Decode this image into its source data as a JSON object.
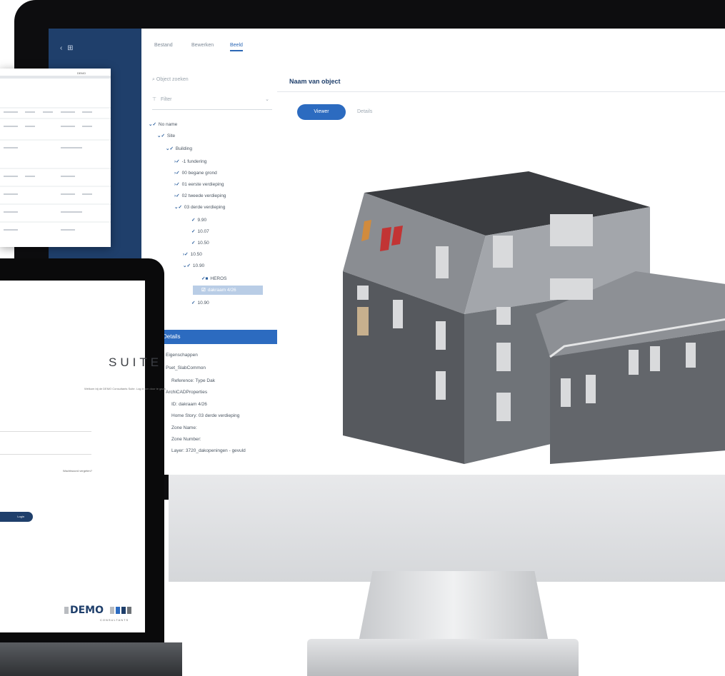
{
  "monitor": {
    "app": {
      "nav_label": "‹ ⊞",
      "tabs": [
        {
          "label": "Bestand"
        },
        {
          "label": "Bewerken"
        },
        {
          "label": "Beeld"
        }
      ],
      "tree": {
        "search_placeholder": "Object zoeken",
        "filter_placeholder": "Filter",
        "items": [
          {
            "label": "No name"
          },
          {
            "label": "Site"
          },
          {
            "label": "Building"
          },
          {
            "label": "-1 fundering"
          },
          {
            "label": "00 begane grond"
          },
          {
            "label": "01 eerste verdieping"
          },
          {
            "label": "02 tweede verdieping"
          },
          {
            "label": "03 derde verdieping"
          },
          {
            "label": "9.90"
          },
          {
            "label": "10.07"
          },
          {
            "label": "10.50"
          },
          {
            "label": "10.50"
          },
          {
            "label": "10.90"
          },
          {
            "label": "HEROS"
          },
          {
            "label": "dakraam 4/26"
          },
          {
            "label": "10.90"
          }
        ]
      },
      "details": {
        "header": "Details",
        "rows": [
          "Eigenschappen",
          "Pset_SlabCommon",
          "Reference: Type Dak",
          "ArchiCADProperties",
          "ID: dakraam 4/26",
          "Home Story: 03 derde verdieping",
          "Zone Name:",
          "Zone Number:",
          "Layer: 3720_dakopeningen - gevuld"
        ]
      },
      "viewer": {
        "title": "Naam van object",
        "primary_tab": "Viewer",
        "secondary_tab": "Details"
      }
    }
  },
  "laptop": {
    "suite_title": "SUITE",
    "subtitle": "Welkom bij de DEMO Consultants Suite. Log in om door te gaan.",
    "forgot_link": "Wachtwoord vergeten?",
    "login_button": "Login",
    "logo_word": "DEMO",
    "logo_sub": "CONSULTANTS"
  },
  "paper": {
    "header_label": "DEMO"
  },
  "colors": {
    "accent": "#2c6bc0",
    "navy": "#1f3f6b",
    "building_gray": "#6f7378"
  }
}
